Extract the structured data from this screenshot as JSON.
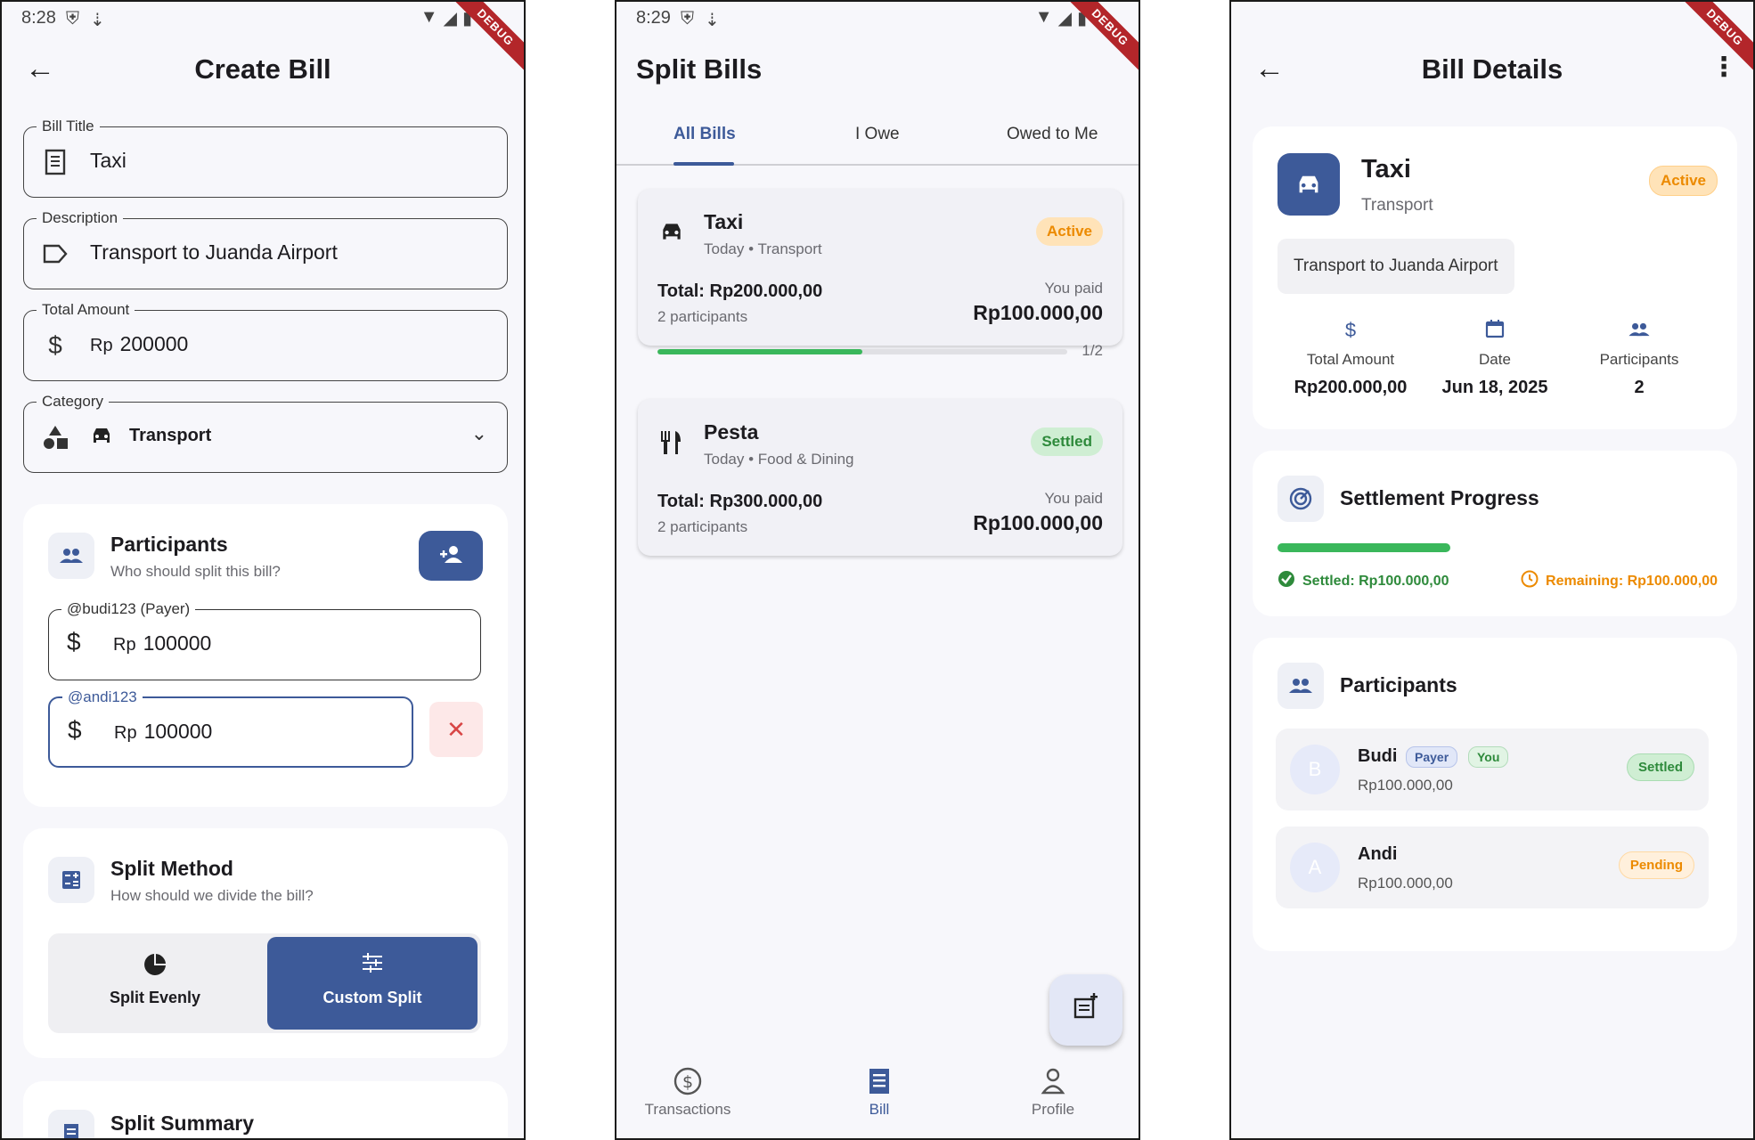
{
  "screen1": {
    "status": {
      "time": "8:28"
    },
    "debug": "DEBUG",
    "title": "Create Bill",
    "fields": {
      "bill_title": {
        "label": "Bill Title",
        "value": "Taxi"
      },
      "description": {
        "label": "Description",
        "value": "Transport to Juanda Airport"
      },
      "total_amount": {
        "label": "Total Amount",
        "prefix": "Rp",
        "value": "200000"
      },
      "category": {
        "label": "Category",
        "value": "Transport"
      }
    },
    "participants": {
      "title": "Participants",
      "subtitle": "Who should split this bill?",
      "items": [
        {
          "label": "@budi123 (Payer)",
          "prefix": "Rp",
          "value": "100000"
        },
        {
          "label": "@andi123",
          "prefix": "Rp",
          "value": "100000"
        }
      ]
    },
    "split_method": {
      "title": "Split Method",
      "subtitle": "How should we divide the bill?",
      "options": [
        {
          "label": "Split Evenly",
          "selected": false
        },
        {
          "label": "Custom Split",
          "selected": true
        }
      ]
    },
    "split_summary": {
      "title": "Split Summary"
    }
  },
  "screen2": {
    "status": {
      "time": "8:29"
    },
    "debug": "DEBUG",
    "title": "Split Bills",
    "tabs": [
      "All Bills",
      "I Owe",
      "Owed to Me"
    ],
    "active_tab": "All Bills",
    "bills": [
      {
        "name": "Taxi",
        "meta": "Today • Transport",
        "status": "Active",
        "total": "Total: Rp200.000,00",
        "participants": "2 participants",
        "paid_label": "You paid",
        "paid": "Rp100.000,00",
        "progress_text": "1/2",
        "progress": 0.5
      },
      {
        "name": "Pesta",
        "meta": "Today • Food & Dining",
        "status": "Settled",
        "total": "Total: Rp300.000,00",
        "participants": "2 participants",
        "paid_label": "You paid",
        "paid": "Rp100.000,00"
      }
    ],
    "nav": [
      {
        "label": "Transactions",
        "icon": "dollar-circle-icon",
        "active": false
      },
      {
        "label": "Bill",
        "icon": "receipt-icon",
        "active": true
      },
      {
        "label": "Profile",
        "icon": "person-icon",
        "active": false
      }
    ]
  },
  "screen3": {
    "debug": "DEBUG",
    "title": "Bill Details",
    "bill": {
      "name": "Taxi",
      "category": "Transport",
      "status": "Active",
      "description": "Transport to Juanda Airport",
      "stats": [
        {
          "icon": "dollar-icon",
          "label": "Total Amount",
          "value": "Rp200.000,00"
        },
        {
          "icon": "calendar-icon",
          "label": "Date",
          "value": "Jun 18, 2025"
        },
        {
          "icon": "people-icon",
          "label": "Participants",
          "value": "2"
        }
      ]
    },
    "settlement": {
      "title": "Settlement Progress",
      "progress": 0.5,
      "settled": "Settled: Rp100.000,00",
      "remaining": "Remaining: Rp100.000,00"
    },
    "participants": {
      "title": "Participants",
      "items": [
        {
          "initial": "B",
          "name": "Budi",
          "amount": "Rp100.000,00",
          "chips": [
            "Payer",
            "You"
          ],
          "status": "Settled"
        },
        {
          "initial": "A",
          "name": "Andi",
          "amount": "Rp100.000,00",
          "chips": [],
          "status": "Pending"
        }
      ]
    }
  },
  "colors": {
    "primary": "#3d5a99",
    "active_badge": "#ec8a00",
    "settled_badge": "#2e8a3b",
    "danger": "#d84545",
    "progress": "#3ab75b"
  }
}
